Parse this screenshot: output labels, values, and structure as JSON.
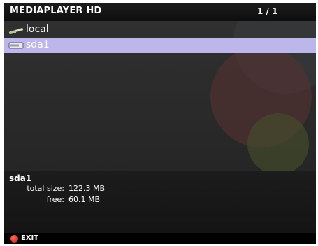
{
  "header": {
    "app_title": "MEDIAPLAYER HD",
    "page_indicator": "1 / 1"
  },
  "list": {
    "items": [
      {
        "label": "local",
        "icon": "network-share-icon",
        "selected": false
      },
      {
        "label": "sda1",
        "icon": "usb-drive-icon",
        "selected": true
      }
    ]
  },
  "info": {
    "name": "sda1",
    "total_label": "total size:",
    "total_value": "122.3 MB",
    "free_label": "free:",
    "free_value": "60.1 MB"
  },
  "footer": {
    "exit_label": "EXIT",
    "exit_icon": "red-button-icon"
  },
  "colors": {
    "selection": "#bcb6ea",
    "background": "#262626",
    "exit_button": "#d8261a"
  }
}
